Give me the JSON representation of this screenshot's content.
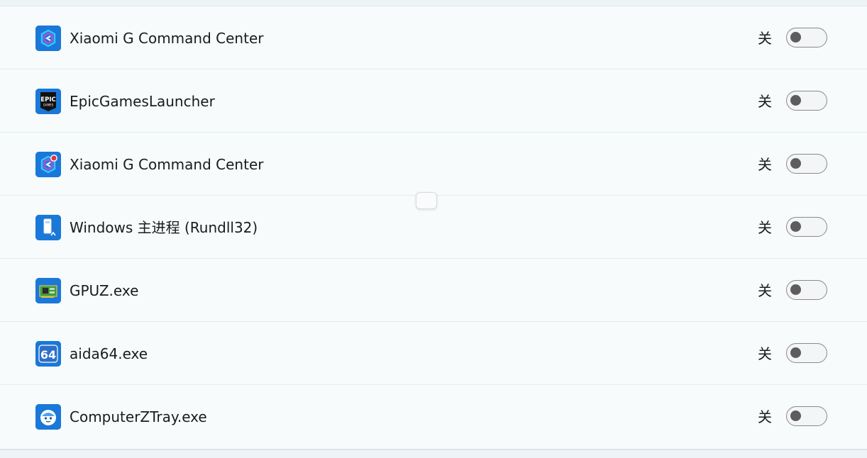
{
  "apps": [
    {
      "name": "Xiaomi G Command Center",
      "state": "关",
      "icon": "xiaomi-g-command-center-icon",
      "on": false
    },
    {
      "name": "EpicGamesLauncher",
      "state": "关",
      "icon": "epic-games-icon",
      "on": false
    },
    {
      "name": "Xiaomi G Command Center",
      "state": "关",
      "icon": "xiaomi-g-command-center-notify-icon",
      "on": false
    },
    {
      "name": "Windows 主进程 (Rundll32)",
      "state": "关",
      "icon": "rundll32-icon",
      "on": false
    },
    {
      "name": "GPUZ.exe",
      "state": "关",
      "icon": "gpuz-icon",
      "on": false
    },
    {
      "name": "aida64.exe",
      "state": "关",
      "icon": "aida64-icon",
      "on": false
    },
    {
      "name": "ComputerZTray.exe",
      "state": "关",
      "icon": "computerz-tray-icon",
      "on": false
    }
  ],
  "icon_text": {
    "epic_line1": "EPIC",
    "epic_line2": "GAMES",
    "aida": "64"
  },
  "colors": {
    "icon_blue": "#1a78d8",
    "toggle_off_knob": "#5d5d5d",
    "toggle_off_border": "#8a8a8a"
  }
}
